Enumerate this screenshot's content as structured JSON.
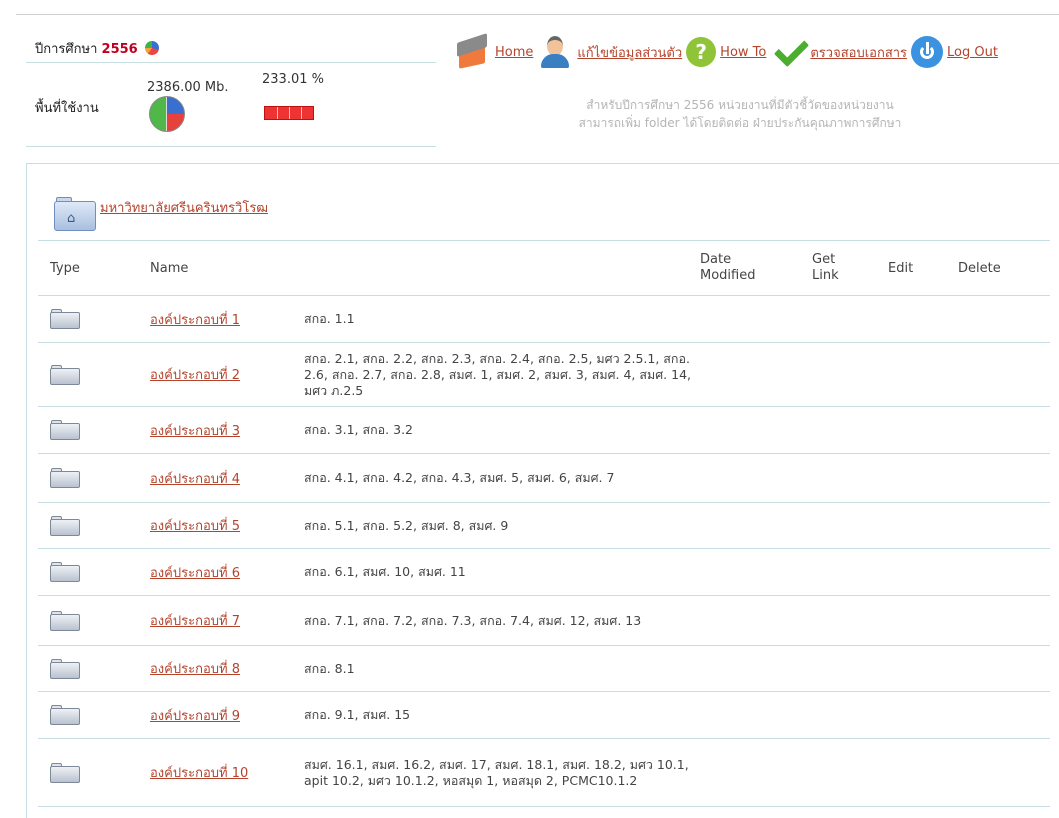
{
  "summary": {
    "year_label": "ปีการศึกษา",
    "year": "2556",
    "usage_label": "พื้นที่ใช้งาน",
    "usage_mb": "2386.00 Mb.",
    "usage_pct": "233.01 %"
  },
  "nav": {
    "home": "Home",
    "profile": "แก้ไขข้อมูลส่วนตัว",
    "howto": "How To",
    "check_docs": "ตรวจสอบเอกสาร",
    "logout": "Log Out"
  },
  "notice": {
    "line1": "สำหรับปีการศึกษา 2556 หน่วยงานที่มีตัวชี้วัดของหน่วยงาน",
    "line2": "สามารถเพิ่ม folder ได้โดยติดต่อ ฝ่ายประกันคุณภาพการศึกษา"
  },
  "breadcrumb": {
    "label": "มหาวิทยาลัยศรีนครินทรวิโรฒ"
  },
  "table": {
    "headers": {
      "type": "Type",
      "name": "Name",
      "date_line1": "Date",
      "date_line2": "Modified",
      "link_line1": "Get",
      "link_line2": "Link",
      "edit": "Edit",
      "delete": "Delete"
    },
    "rows": [
      {
        "name": "องค์ประกอบที่ 1",
        "desc": "สกอ. 1.1"
      },
      {
        "name": "องค์ประกอบที่ 2",
        "desc": "สกอ. 2.1, สกอ. 2.2, สกอ. 2.3, สกอ. 2.4, สกอ. 2.5, มศว 2.5.1, สกอ. 2.6, สกอ. 2.7, สกอ. 2.8, สมศ. 1, สมศ. 2, สมศ. 3, สมศ. 4, สมศ. 14, มศว ภ.2.5"
      },
      {
        "name": "องค์ประกอบที่ 3",
        "desc": "สกอ. 3.1, สกอ. 3.2"
      },
      {
        "name": "องค์ประกอบที่ 4",
        "desc": "สกอ. 4.1, สกอ. 4.2, สกอ. 4.3, สมศ. 5, สมศ. 6, สมศ. 7"
      },
      {
        "name": "องค์ประกอบที่ 5",
        "desc": "สกอ. 5.1, สกอ. 5.2, สมศ. 8, สมศ. 9"
      },
      {
        "name": "องค์ประกอบที่ 6",
        "desc": "สกอ. 6.1, สมศ. 10, สมศ. 11"
      },
      {
        "name": "องค์ประกอบที่ 7",
        "desc": "สกอ. 7.1, สกอ. 7.2, สกอ. 7.3, สกอ. 7.4, สมศ. 12, สมศ. 13"
      },
      {
        "name": "องค์ประกอบที่ 8",
        "desc": "สกอ. 8.1"
      },
      {
        "name": "องค์ประกอบที่ 9",
        "desc": "สกอ. 9.1, สมศ. 15"
      },
      {
        "name": "องค์ประกอบที่ 10",
        "desc": "สมศ. 16.1, สมศ. 16.2, สมศ. 17, สมศ. 18.1, สมศ. 18.2, มศว 10.1, apit 10.2, มศว 10.1.2, หอสมุด 1, หอสมุด 2, PCMC10.1.2"
      }
    ]
  },
  "colors": {
    "link": "#b4442c",
    "year": "#c0001f",
    "divider": "#c7dfe2"
  }
}
